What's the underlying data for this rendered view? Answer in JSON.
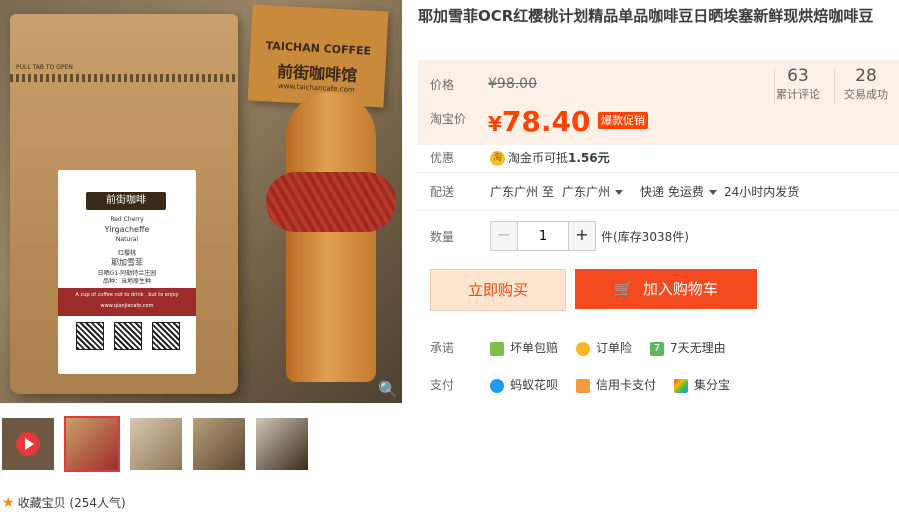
{
  "product": {
    "title": "耶加雪菲OCR红樱桃计划精品单品咖啡豆日晒埃塞新鲜现烘焙咖啡豆"
  },
  "image_text": {
    "bag_label_lines": [
      "前街咖啡",
      "Red Cherry",
      "Yirgacheffe",
      "Natural",
      "红樱桃",
      "耶加雪菲",
      "日晒G1-阿勒特兰庄园",
      "品种：当地原生种",
      "A cup of coffee not to drink , but to enjoy",
      "www.qianjiecafe.com"
    ],
    "bag_tab": "PULL TAB TO OPEN",
    "card_brand": "TAICHAN COFFEE",
    "card_cn": "前街咖啡馆",
    "card_url": "www.taichancafe.com"
  },
  "price": {
    "label": "价格",
    "original": "¥98.00",
    "taobao_label": "淘宝价",
    "currency": "¥",
    "current": "78.40",
    "promo_badge": "爆款促销"
  },
  "stats": {
    "reviews_count": "63",
    "reviews_label": "累计评论",
    "deals_count": "28",
    "deals_label": "交易成功"
  },
  "discount": {
    "label": "优惠",
    "coin_icon": "淘",
    "text": "淘金币可抵",
    "amount": "1.56元"
  },
  "shipping": {
    "label": "配送",
    "from": "广东广州",
    "to_word": "至",
    "to": "广东广州",
    "method": "快递 免运费",
    "dispatch": "24小时内发货"
  },
  "quantity": {
    "label": "数量",
    "minus": "−",
    "plus": "+",
    "value": "1",
    "stock": "件(库存3038件)"
  },
  "buttons": {
    "buy_now": "立即购买",
    "add_to_cart": "加入购物车"
  },
  "promises": {
    "label": "承诺",
    "items": [
      "坏单包赔",
      "订单险",
      "7天无理由"
    ]
  },
  "payment": {
    "label": "支付",
    "items": [
      "蚂蚁花呗",
      "信用卡支付",
      "集分宝"
    ]
  },
  "favorite": {
    "text": "收藏宝贝",
    "popularity": "(254人气)"
  },
  "colors": {
    "accent": "#ff4400",
    "price_bg": "#fdf0e6",
    "cart_button": "#f44a1f"
  }
}
